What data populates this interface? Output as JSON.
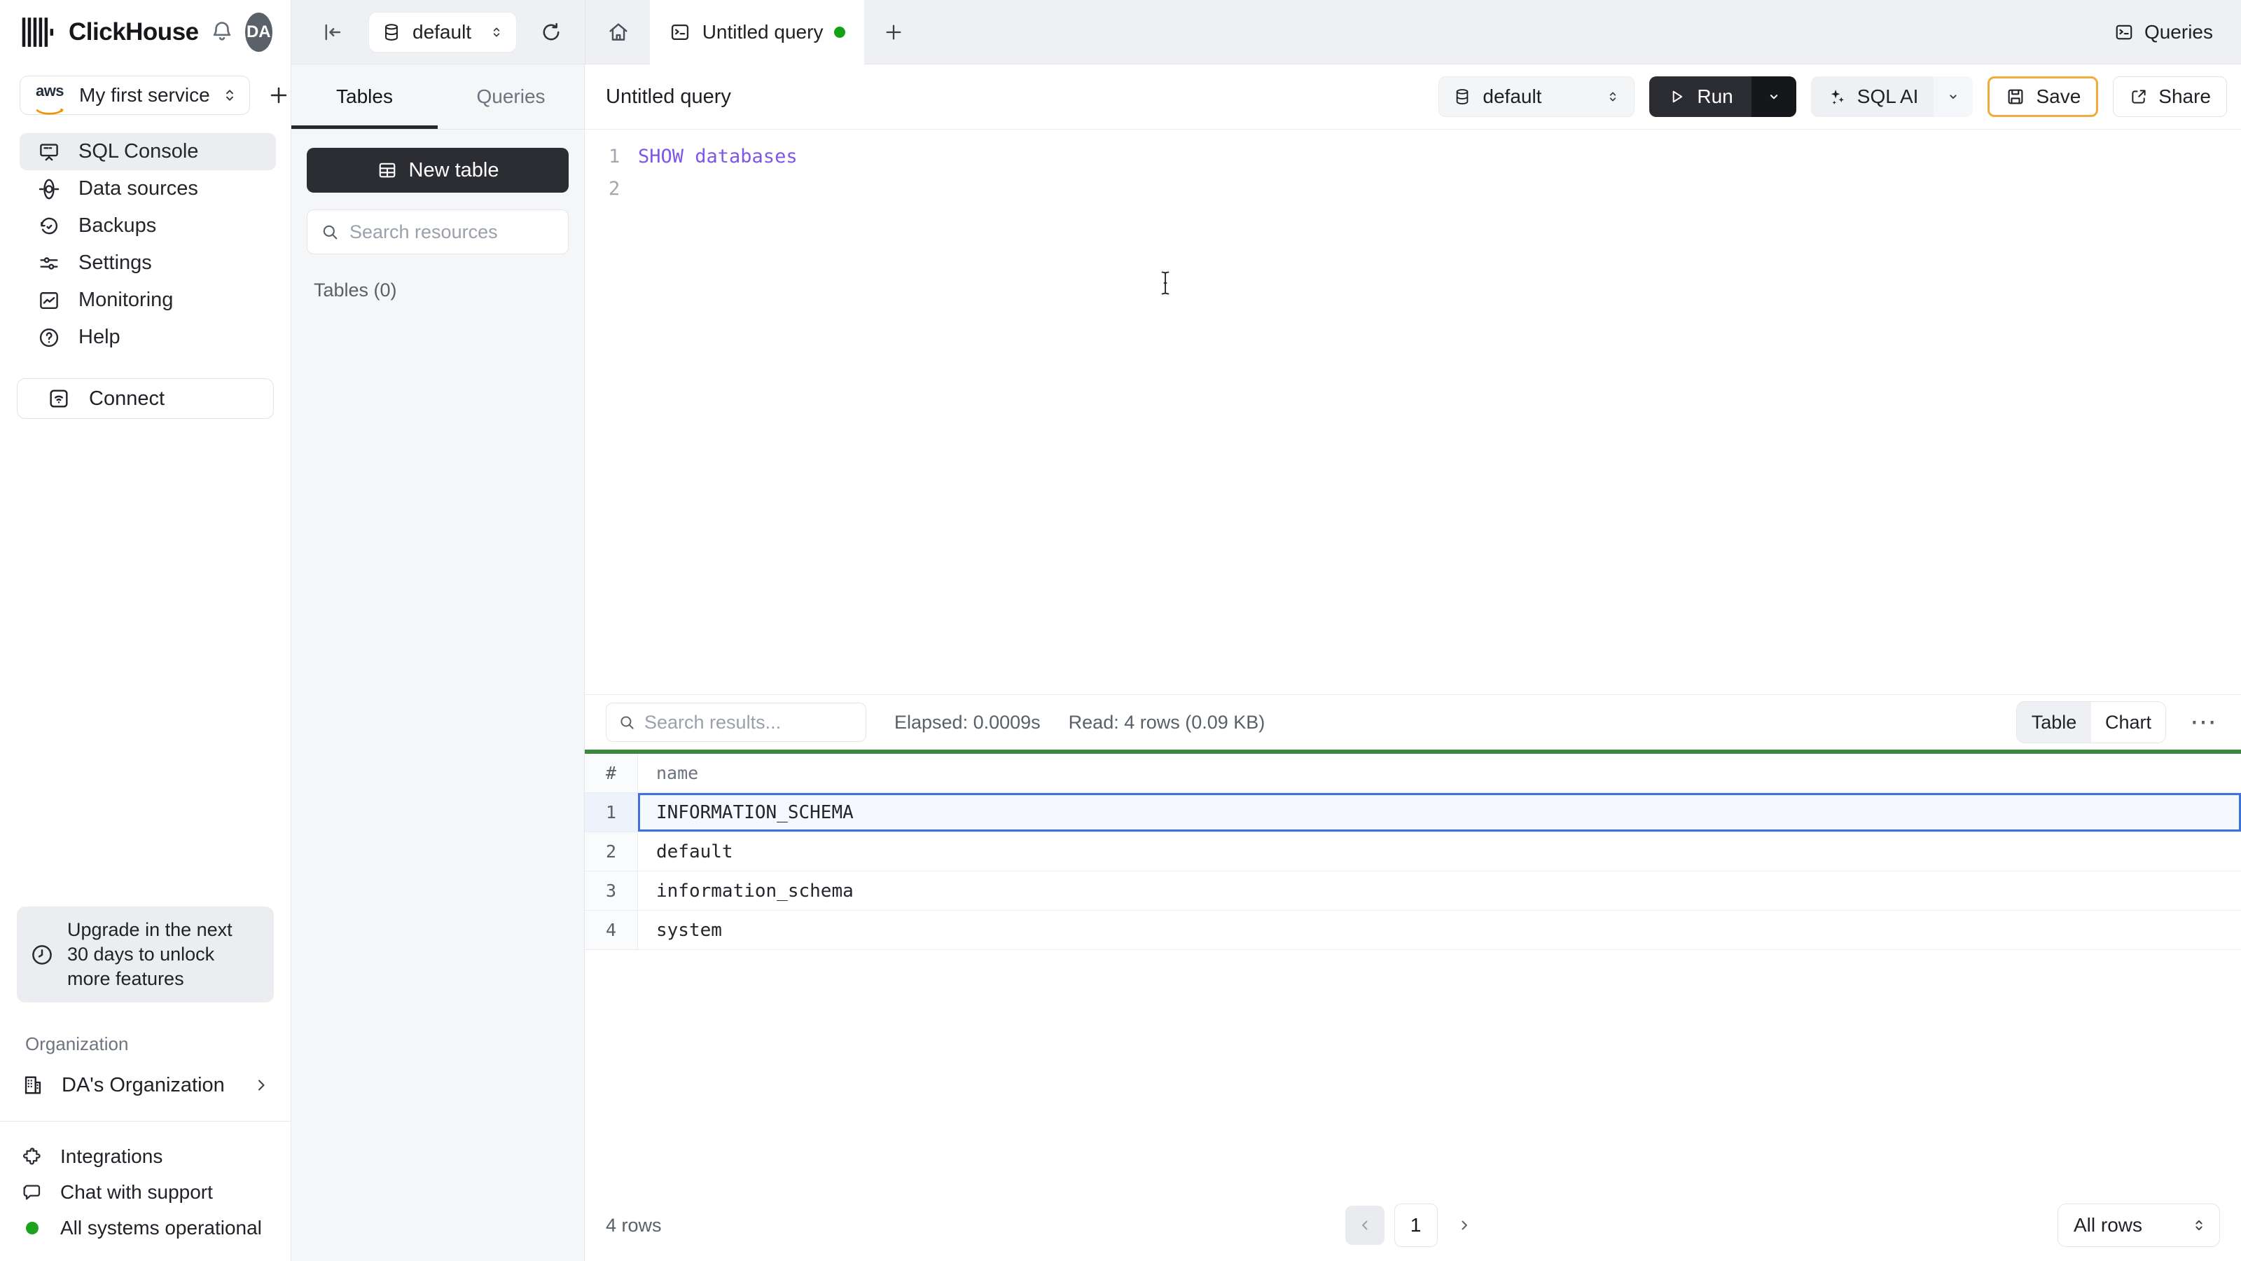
{
  "app": {
    "brand": "ClickHouse",
    "avatar_initials": "DA",
    "queries_button": "Queries"
  },
  "tabbar": {
    "database_selector": "default",
    "tab_title": "Untitled query"
  },
  "sidebar": {
    "service_name": "My first service",
    "cloud_provider": "aws",
    "items": [
      {
        "label": "SQL Console",
        "icon": "console-icon"
      },
      {
        "label": "Data sources",
        "icon": "data-sources-icon"
      },
      {
        "label": "Backups",
        "icon": "backups-icon"
      },
      {
        "label": "Settings",
        "icon": "settings-icon"
      },
      {
        "label": "Monitoring",
        "icon": "monitoring-icon"
      },
      {
        "label": "Help",
        "icon": "help-icon"
      }
    ],
    "connect_label": "Connect",
    "upgrade_notice": "Upgrade in the next 30 days to unlock more features",
    "organization_label": "Organization",
    "organization_name": "DA's Organization",
    "footer_items": [
      {
        "label": "Integrations",
        "icon": "puzzle-icon"
      },
      {
        "label": "Chat with support",
        "icon": "chat-icon"
      },
      {
        "label": "All systems operational",
        "icon": "status-dot"
      }
    ]
  },
  "resources_panel": {
    "tabs": [
      {
        "label": "Tables"
      },
      {
        "label": "Queries"
      }
    ],
    "active_tab": "Tables",
    "new_table_label": "New table",
    "search_placeholder": "Search resources",
    "section_label": "Tables (0)"
  },
  "query_editor": {
    "title": "Untitled query",
    "database_selector": "default",
    "run_label": "Run",
    "sql_ai_label": "SQL AI",
    "save_label": "Save",
    "share_label": "Share",
    "lines": [
      {
        "number": "1",
        "code": "SHOW databases"
      },
      {
        "number": "2",
        "code": ""
      }
    ]
  },
  "results": {
    "search_placeholder": "Search results...",
    "elapsed": "Elapsed: 0.0009s",
    "read": "Read: 4 rows (0.09 KB)",
    "view_toggle": [
      {
        "label": "Table"
      },
      {
        "label": "Chart"
      }
    ],
    "active_view": "Table",
    "table": {
      "columns": {
        "num": "#",
        "name": "name"
      },
      "rows": [
        {
          "n": "1",
          "name": "INFORMATION_SCHEMA",
          "selected": true
        },
        {
          "n": "2",
          "name": "default",
          "selected": false
        },
        {
          "n": "3",
          "name": "information_schema",
          "selected": false
        },
        {
          "n": "4",
          "name": "system",
          "selected": false
        }
      ]
    },
    "footer": {
      "row_count": "4 rows",
      "page": "1",
      "rows_selector": "All rows"
    }
  },
  "colors": {
    "accent_amber": "#EFAC3B",
    "selection_blue": "#3E74DA",
    "success_green_bar": "#3B873D",
    "status_green": "#1EA21E",
    "keyword_purple": "#7C57E8",
    "aws_orange": "#F29101",
    "dark_button": "#2B2D33"
  }
}
